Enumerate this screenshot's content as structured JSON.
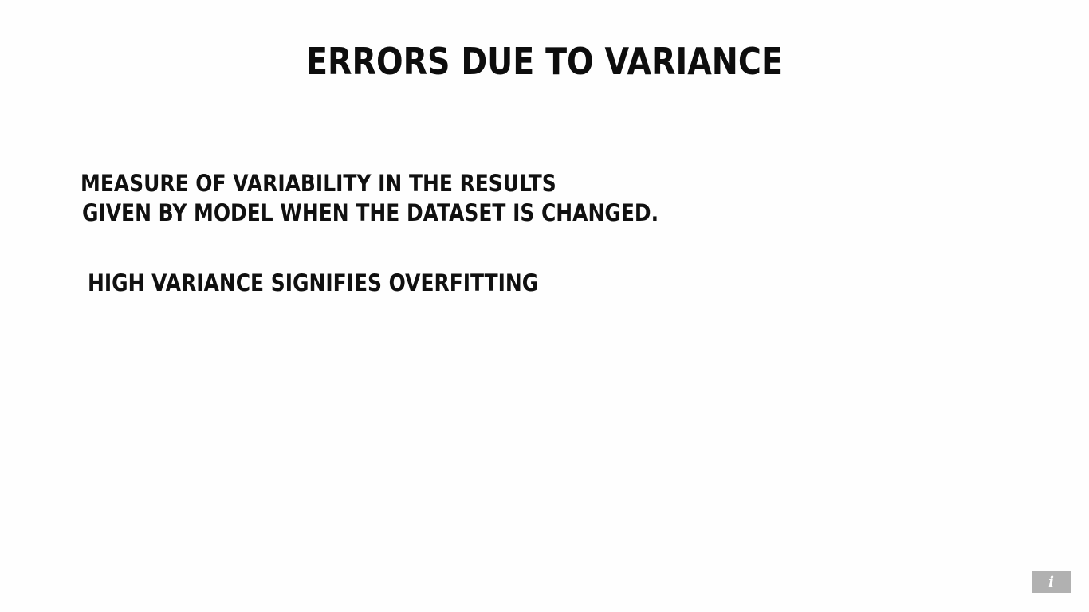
{
  "slide": {
    "title": "ERRORS DUE TO VARIANCE",
    "lines": [
      "MEASURE OF VARIABILITY IN THE RESULTS",
      "GIVEN BY MODEL WHEN THE DATASET IS CHANGED.",
      "HIGH VARIANCE SIGNIFIES OVERFITTING"
    ]
  },
  "controls": {
    "info_icon": "i"
  },
  "colors": {
    "background": "#ffffff",
    "text": "#111111",
    "info_button": "#a9a9a9"
  }
}
